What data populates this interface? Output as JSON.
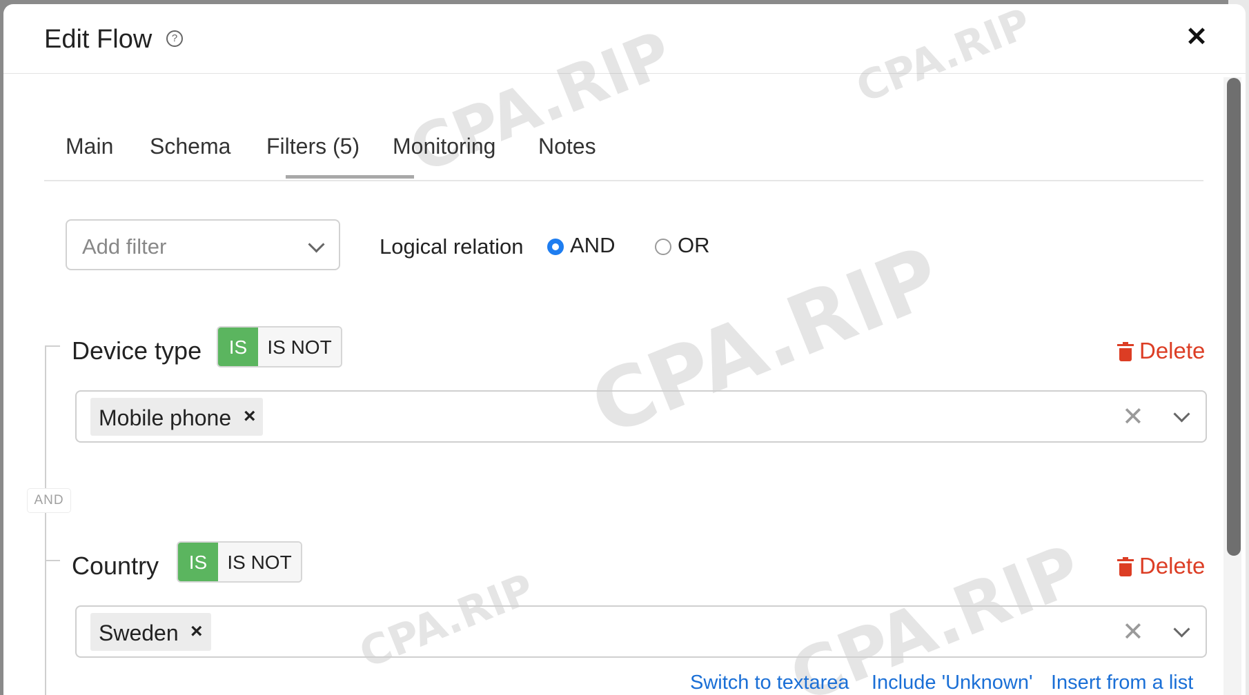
{
  "modal": {
    "title": "Edit Flow",
    "help_icon": "question-circle-icon",
    "close_icon": "close-icon"
  },
  "tabs": [
    {
      "label": "Main",
      "active": false
    },
    {
      "label": "Schema",
      "active": false
    },
    {
      "label": "Filters (5)",
      "active": true
    },
    {
      "label": "Monitoring",
      "active": false
    },
    {
      "label": "Notes",
      "active": false
    }
  ],
  "add_filter": {
    "placeholder": "Add filter"
  },
  "logical_relation": {
    "label": "Logical relation",
    "options": [
      {
        "label": "AND",
        "selected": true
      },
      {
        "label": "OR",
        "selected": false
      }
    ]
  },
  "connector_label": "AND",
  "filters": [
    {
      "name": "Device type",
      "is_label": "IS",
      "is_not_label": "IS NOT",
      "mode": "IS",
      "delete_label": "Delete",
      "values": [
        "Mobile phone"
      ]
    },
    {
      "name": "Country",
      "is_label": "IS",
      "is_not_label": "IS NOT",
      "mode": "IS",
      "delete_label": "Delete",
      "values": [
        "Sweden"
      ]
    }
  ],
  "country_links": [
    "Switch to textarea",
    "Include 'Unknown'",
    "Insert from a list"
  ],
  "watermark": "CPA.RIP",
  "colors": {
    "accent_blue": "#1e7df0",
    "is_green": "#5bb55f",
    "delete_red": "#dc3d24",
    "link_blue": "#1a6fd6"
  }
}
